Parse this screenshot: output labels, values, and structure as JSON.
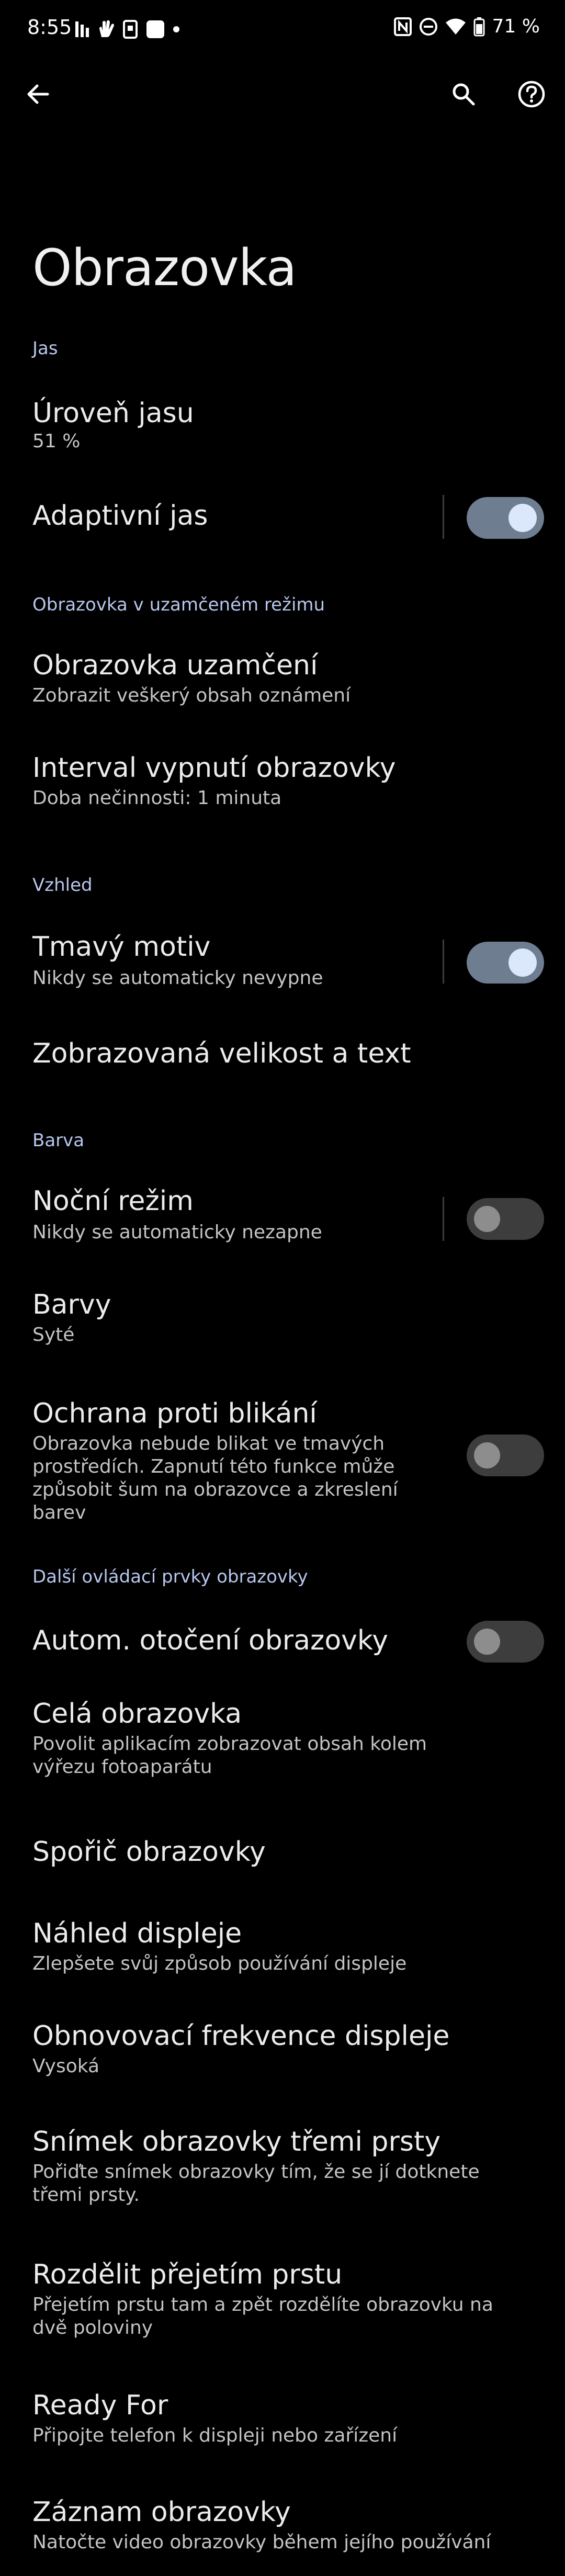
{
  "status_bar": {
    "time": "8:55",
    "battery_percent": "71 %",
    "left_icons": [
      "notification-icon-1",
      "gesture-icon",
      "device-icon",
      "square-app-icon",
      "dot-icon"
    ],
    "right_icons": [
      "nfc-icon",
      "do-not-disturb-icon",
      "wifi-icon",
      "battery-icon"
    ]
  },
  "header": {
    "title": "Obrazovka"
  },
  "sections": {
    "brightness": {
      "label": "Jas",
      "level_title": "Úroveň jasu",
      "level_value": "51 %",
      "adaptive_title": "Adaptivní jas",
      "adaptive_on": true
    },
    "lock": {
      "label": "Obrazovka v uzamčeném režimu",
      "lockscreen_title": "Obrazovka uzamčení",
      "lockscreen_summary": "Zobrazit veškerý obsah oznámení",
      "timeout_title": "Interval vypnutí obrazovky",
      "timeout_summary": "Doba nečinnosti: 1 minuta"
    },
    "appearance": {
      "label": "Vzhled",
      "dark_title": "Tmavý motiv",
      "dark_summary": "Nikdy se automaticky nevypne",
      "dark_on": true,
      "size_title": "Zobrazovaná velikost a text"
    },
    "color": {
      "label": "Barva",
      "night_title": "Noční režim",
      "night_summary": "Nikdy se automaticky nezapne",
      "night_on": false,
      "colors_title": "Barvy",
      "colors_summary": "Syté",
      "flicker_title": "Ochrana proti blikání",
      "flicker_summary": "Obrazovka nebude blikat ve tmavých prostředích. Zapnutí této funkce může způsobit šum na obrazovce a zkreslení barev",
      "flicker_on": false
    },
    "other": {
      "label": "Další ovládací prvky obrazovky",
      "rotate_title": "Autom. otočení obrazovky",
      "rotate_on": false,
      "fullscreen_title": "Celá obrazovka",
      "fullscreen_summary": "Povolit aplikacím zobrazovat obsah kolem výřezu fotoaparátu",
      "saver_title": "Spořič obrazovky",
      "preview_title": "Náhled displeje",
      "preview_summary": "Zlepšete svůj způsob používání displeje",
      "refresh_title": "Obnovovací frekvence displeje",
      "refresh_summary": "Vysoká",
      "three_finger_title": "Snímek obrazovky třemi prsty",
      "three_finger_summary": "Pořiďte snímek obrazovky tím, že se jí dotknete třemi prsty.",
      "split_title": "Rozdělit přejetím prstu",
      "split_summary": "Přejetím prstu tam a zpět rozdělíte obrazovku na dvě poloviny",
      "ready_title": "Ready For",
      "ready_summary": "Připojte telefon k displeji nebo zařízení",
      "record_title": "Záznam obrazovky",
      "record_summary": "Natočte video obrazovky během jejího používání"
    }
  },
  "colors": {
    "background": "#000000",
    "accent": "#b8c7ee",
    "switch_on_track": "#6f7d90",
    "switch_on_thumb": "#dbe8fb",
    "switch_off_track": "#3d3d3d",
    "switch_off_thumb": "#8d8d8d"
  }
}
